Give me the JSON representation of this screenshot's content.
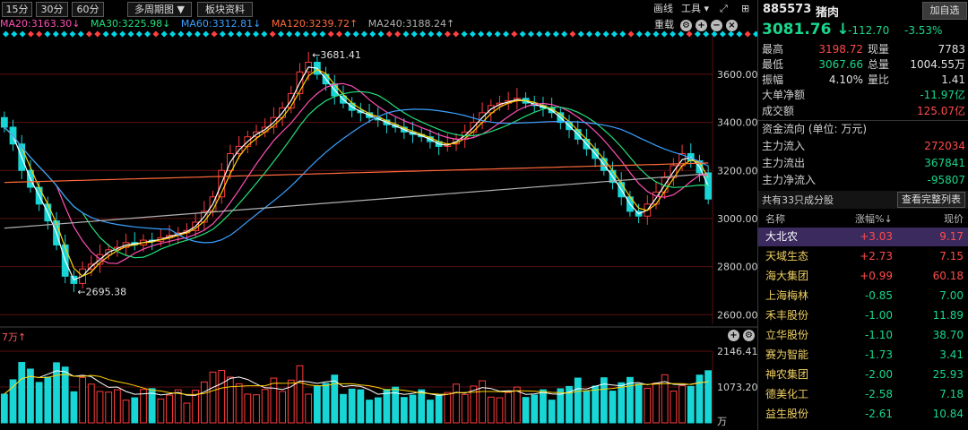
{
  "toolbar": {
    "periods": [
      "15分",
      "30分",
      "60分"
    ],
    "multi_period": "多周期图 ▼",
    "sector_info": "板块资料",
    "draw_line": "画线",
    "tools": "工具 ▾"
  },
  "ma_indicators": [
    {
      "label": "MA20:3163.30↓",
      "color": "#ff4fb5"
    },
    {
      "label": "MA30:3225.98↓",
      "color": "#22e07a"
    },
    {
      "label": "MA60:3312.81↓",
      "color": "#3aa0ff"
    },
    {
      "label": "MA120:3239.72↑",
      "color": "#ff6a3a"
    },
    {
      "label": "MA240:3188.24↑",
      "color": "#b0b0b0"
    }
  ],
  "chart_controls": {
    "zhongdang": "重载"
  },
  "volume_header": "7万↑",
  "volume_unit": "万",
  "colors": {
    "up": "#ff3b3b",
    "down": "#19d6d6",
    "background": "#000000"
  },
  "chart_data": {
    "type": "candlestick",
    "price_axis": {
      "range": [
        2560,
        3760
      ],
      "ticks": [
        "3600.00",
        "3400.00",
        "3200.00",
        "3000.00",
        "2800.00",
        "2600.00"
      ]
    },
    "volume_axis": {
      "range": [
        0,
        2146.41
      ],
      "ticks": [
        "2146.41",
        "1073.20"
      ]
    },
    "annotations": {
      "high": "←3681.41",
      "low": "←2695.38"
    },
    "series_shape": {
      "close": [
        3380,
        3310,
        3200,
        3130,
        3060,
        2990,
        2890,
        2760,
        2730,
        2790,
        2810,
        2850,
        2870,
        2880,
        2900,
        2890,
        2910,
        2905,
        2920,
        2930,
        2940,
        2950,
        2985,
        3030,
        3090,
        3200,
        3270,
        3300,
        3340,
        3360,
        3380,
        3420,
        3460,
        3520,
        3610,
        3650,
        3600,
        3560,
        3510,
        3480,
        3450,
        3440,
        3420,
        3410,
        3390,
        3380,
        3360,
        3350,
        3340,
        3320,
        3300,
        3310,
        3330,
        3360,
        3400,
        3440,
        3470,
        3480,
        3490,
        3500,
        3480,
        3470,
        3460,
        3440,
        3400,
        3370,
        3330,
        3290,
        3250,
        3200,
        3150,
        3090,
        3030,
        3010,
        3060,
        3110,
        3170,
        3220,
        3270,
        3240,
        3190,
        3081
      ]
    }
  },
  "panel": {
    "code": "885573",
    "name": "猪肉",
    "add_button": "加自选",
    "price": "3081.76",
    "arrow": "↓",
    "change": "-112.70",
    "change_pct": "-3.53%",
    "stats": [
      {
        "l1": "最高",
        "v1": "3198.72",
        "c1": "r",
        "l2": "现量",
        "v2": "7783",
        "c2": "w"
      },
      {
        "l1": "最低",
        "v1": "3067.66",
        "c1": "g",
        "l2": "总量",
        "v2": "1004.55万",
        "c2": "w"
      },
      {
        "l1": "振幅",
        "v1": "4.10%",
        "c1": "w",
        "l2": "量比",
        "v2": "1.41",
        "c2": "w"
      }
    ],
    "big_net": {
      "label": "大单净额",
      "value": "-11.97亿"
    },
    "turnover": {
      "label": "成交额",
      "value": "125.07亿"
    },
    "fund_flow_title": "资金流向 (单位: 万元)",
    "flows": [
      {
        "label": "主力流入",
        "value": "272034",
        "c": "r"
      },
      {
        "label": "主力流出",
        "value": "367841",
        "c": "g"
      },
      {
        "label": "主力净流入",
        "value": "-95807",
        "c": "g"
      }
    ],
    "constituents_title": "共有33只成分股",
    "view_full": "查看完整列表",
    "columns": {
      "name": "名称",
      "pct": "涨幅%↓",
      "price": "现价"
    },
    "stocks": [
      {
        "name": "大北农",
        "pct": "+3.03",
        "price": "9.17",
        "c": "r",
        "sel": true
      },
      {
        "name": "天域生态",
        "pct": "+2.73",
        "price": "7.15",
        "c": "r",
        "sel": false
      },
      {
        "name": "海大集团",
        "pct": "+0.99",
        "price": "60.18",
        "c": "r",
        "sel": false
      },
      {
        "name": "上海梅林",
        "pct": "-0.85",
        "price": "7.00",
        "c": "g",
        "sel": false
      },
      {
        "name": "禾丰股份",
        "pct": "-1.00",
        "price": "11.89",
        "c": "g",
        "sel": false
      },
      {
        "name": "立华股份",
        "pct": "-1.10",
        "price": "38.70",
        "c": "g",
        "sel": false
      },
      {
        "name": "赛为智能",
        "pct": "-1.73",
        "price": "3.41",
        "c": "g",
        "sel": false
      },
      {
        "name": "神农集团",
        "pct": "-2.00",
        "price": "25.93",
        "c": "g",
        "sel": false
      },
      {
        "name": "德美化工",
        "pct": "-2.58",
        "price": "7.18",
        "c": "g",
        "sel": false
      },
      {
        "name": "益生股份",
        "pct": "-2.61",
        "price": "10.84",
        "c": "g",
        "sel": false
      }
    ]
  }
}
